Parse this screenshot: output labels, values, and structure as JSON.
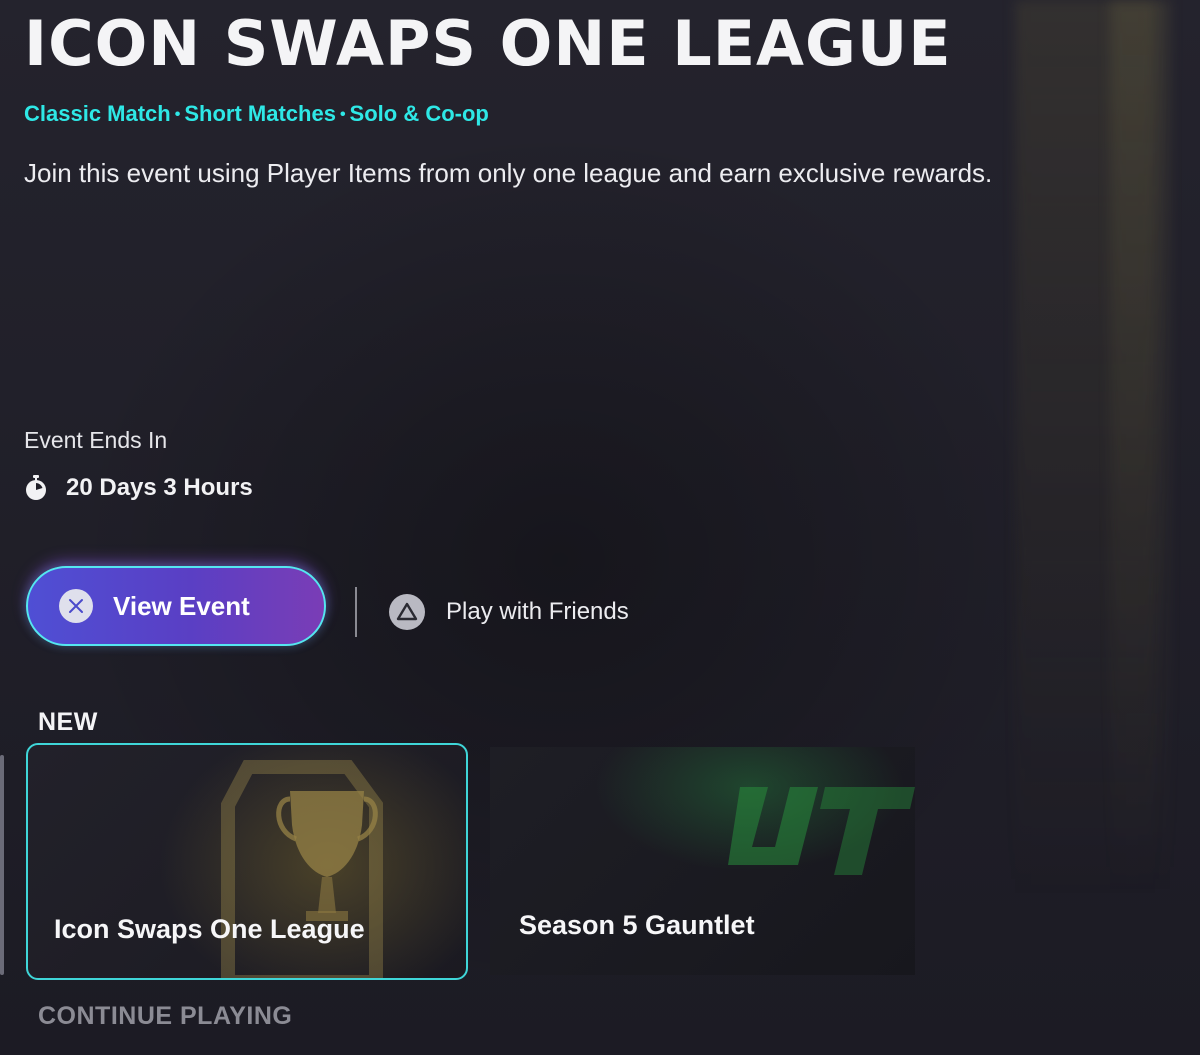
{
  "event": {
    "title": "ICON SWAPS ONE LEAGUE",
    "modes": [
      "Classic Match",
      "Short Matches",
      "Solo & Co-op"
    ],
    "mode_separator": "•",
    "description": "Join this event using Player Items from only one league and earn exclusive rewards.",
    "ends_label": "Event Ends In",
    "time_remaining": "20 Days 3 Hours"
  },
  "actions": {
    "view_event_label": "View Event",
    "view_event_icon": "cross-button-icon",
    "play_friends_label": "Play with Friends",
    "play_friends_icon": "triangle-button-icon"
  },
  "sections": {
    "new_label": "NEW",
    "continue_label": "CONTINUE PLAYING"
  },
  "cards": [
    {
      "title": "Icon Swaps One League",
      "icon": "trophy-icon",
      "selected": true
    },
    {
      "title": "Season 5 Gauntlet",
      "icon": "ut-logo-icon",
      "selected": false
    }
  ],
  "colors": {
    "background": "#1f1e27",
    "accent_cyan": "#2ee8e6",
    "button_gradient_start": "#4f4fd4",
    "button_gradient_end": "#7a3db6",
    "card_border": "#3fd6d8",
    "muted_text": "#8b8b94"
  }
}
